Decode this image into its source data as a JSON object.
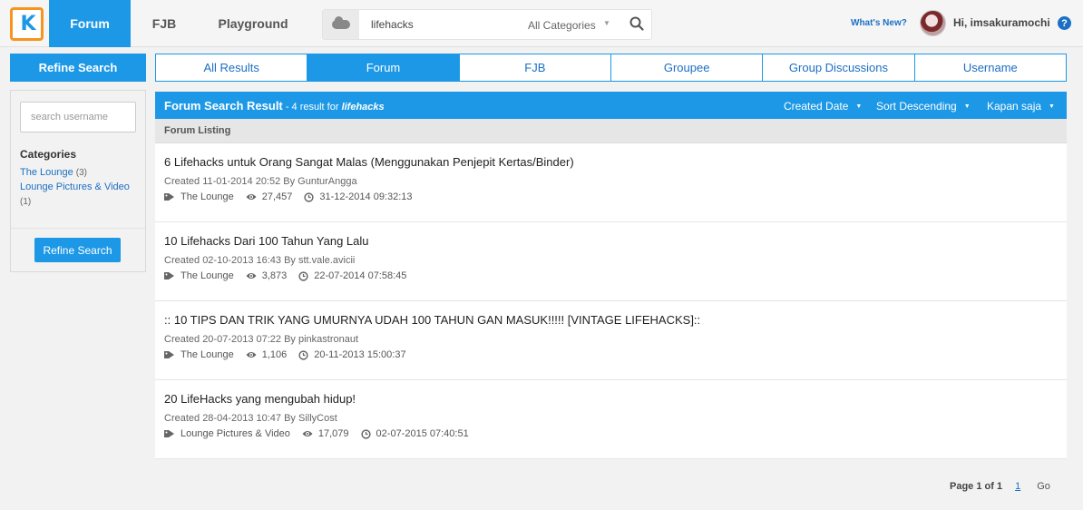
{
  "nav": {
    "logo_text": "K",
    "tabs": [
      {
        "label": "Forum",
        "active": true
      },
      {
        "label": "FJB",
        "active": false
      },
      {
        "label": "Playground",
        "active": false
      }
    ],
    "search_value": "lifehacks",
    "category_select": "All Categories",
    "whats_new": "What's New?",
    "greeting": "Hi, imsakuramochi",
    "help": "?"
  },
  "sidebar": {
    "refine_title": "Refine Search",
    "username_placeholder": "search username",
    "categories_title": "Categories",
    "categories": [
      {
        "name": "The Lounge",
        "count": "(3)"
      },
      {
        "name": "Lounge Pictures & Video",
        "count": "(1)"
      }
    ],
    "refine_button": "Refine Search"
  },
  "result_tabs": [
    {
      "label": "All Results",
      "active": false
    },
    {
      "label": "Forum",
      "active": true
    },
    {
      "label": "FJB",
      "active": false
    },
    {
      "label": "Groupee",
      "active": false
    },
    {
      "label": "Group Discussions",
      "active": false
    },
    {
      "label": "Username",
      "active": false
    }
  ],
  "results_header": {
    "title": "Forum Search Result",
    "count_text": " - 4 result for ",
    "query": "lifehacks",
    "sort_date": "Created Date",
    "sort_order": "Sort Descending",
    "time_filter": "Kapan saja"
  },
  "listing_label": "Forum Listing",
  "threads": [
    {
      "title": "6 Lifehacks untuk Orang Sangat Malas (Menggunakan Penjepit Kertas/Binder)",
      "created": "Created 11-01-2014 20:52 By GunturAngga",
      "category": "The Lounge",
      "views": "27,457",
      "last": "31-12-2014 09:32:13"
    },
    {
      "title": "10 Lifehacks Dari 100 Tahun Yang Lalu",
      "created": "Created 02-10-2013 16:43 By stt.vale.avicii",
      "category": "The Lounge",
      "views": "3,873",
      "last": "22-07-2014 07:58:45"
    },
    {
      "title": ":: 10 TIPS DAN TRIK YANG UMURNYA UDAH 100 TAHUN GAN MASUK!!!!! [VINTAGE LIFEHACKS]::",
      "created": "Created 20-07-2013 07:22 By pinkastronaut",
      "category": "The Lounge",
      "views": "1,106",
      "last": "20-11-2013 15:00:37"
    },
    {
      "title": "20 LifeHacks yang mengubah hidup!",
      "created": "Created 28-04-2013 10:47 By SillyCost",
      "category": "Lounge Pictures & Video",
      "views": "17,079",
      "last": "02-07-2015 07:40:51"
    }
  ],
  "pager": {
    "label": "Page 1 of 1",
    "current": "1",
    "go": "Go"
  },
  "colors": {
    "accent": "#1c98e6",
    "logo_border": "#f7941d",
    "link": "#1c6fc4"
  }
}
